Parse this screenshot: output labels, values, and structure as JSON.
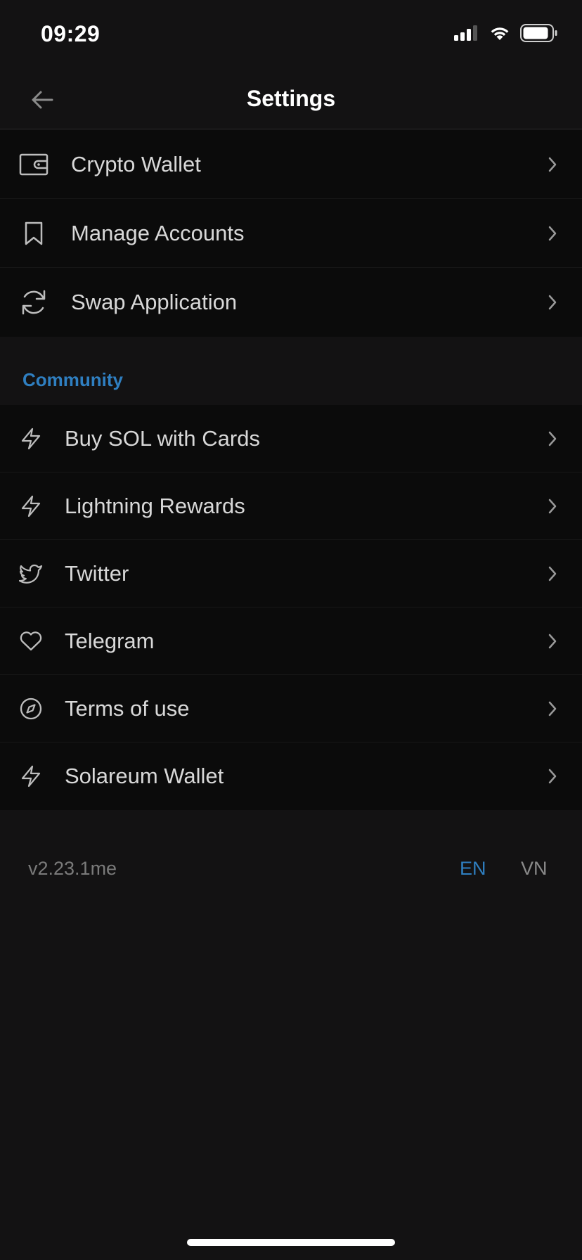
{
  "status_bar": {
    "time": "09:29",
    "icons": [
      "signal-icon",
      "wifi-icon",
      "battery-icon"
    ]
  },
  "nav": {
    "title": "Settings",
    "back_icon": "arrow-left-icon"
  },
  "main_menu": [
    {
      "label": "Crypto Wallet",
      "icon": "wallet-icon"
    },
    {
      "label": "Manage Accounts",
      "icon": "bookmark-icon"
    },
    {
      "label": "Swap Application",
      "icon": "refresh-icon"
    }
  ],
  "community": {
    "header": "Community",
    "items": [
      {
        "label": "Buy SOL with Cards",
        "icon": "lightning-icon"
      },
      {
        "label": "Lightning Rewards",
        "icon": "lightning-icon"
      },
      {
        "label": "Twitter",
        "icon": "twitter-icon"
      },
      {
        "label": "Telegram",
        "icon": "heart-icon"
      },
      {
        "label": "Terms of use",
        "icon": "compass-icon"
      },
      {
        "label": "Solareum Wallet",
        "icon": "lightning-icon"
      }
    ]
  },
  "footer": {
    "version": "v2.23.1me",
    "languages": [
      {
        "label": "EN",
        "selected": true
      },
      {
        "label": "VN",
        "selected": false
      }
    ]
  },
  "colors": {
    "background": "#131213",
    "row_background": "#0b0b0b",
    "accent": "#2f7fc1",
    "text": "#d8d8d8",
    "muted": "#7a7a7a"
  }
}
